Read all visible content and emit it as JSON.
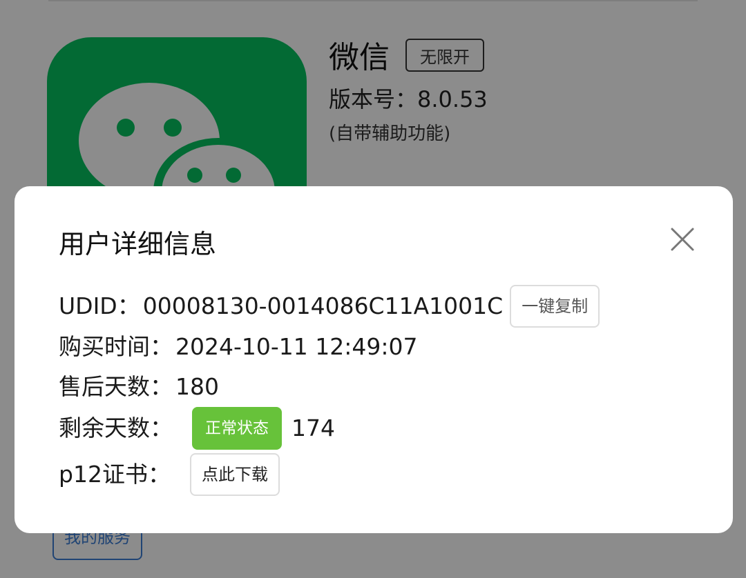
{
  "app": {
    "name": "微信",
    "tag": "无限开",
    "version": "版本号：8.0.53",
    "note": "(自带辅助功能)",
    "icon": "wechat-logo-icon",
    "brand_color": "#07c160"
  },
  "background": {
    "service_button": "我的服务"
  },
  "dialog": {
    "title": "用户详细信息",
    "close_icon": "close-icon",
    "udid": {
      "label": "UDID：",
      "value": "00008130-0014086C11A1001C",
      "copy_button": "一键复制"
    },
    "purchase_time": {
      "label": "购买时间：",
      "value": "2024-10-11 12:49:07"
    },
    "after_sales_days": {
      "label": "售后天数：",
      "value": "180"
    },
    "remaining_days": {
      "label": "剩余天数：",
      "status": "正常状态",
      "status_color": "#67c23a",
      "value": "174"
    },
    "p12_cert": {
      "label": "p12证书：",
      "download_button": "点此下载"
    }
  }
}
